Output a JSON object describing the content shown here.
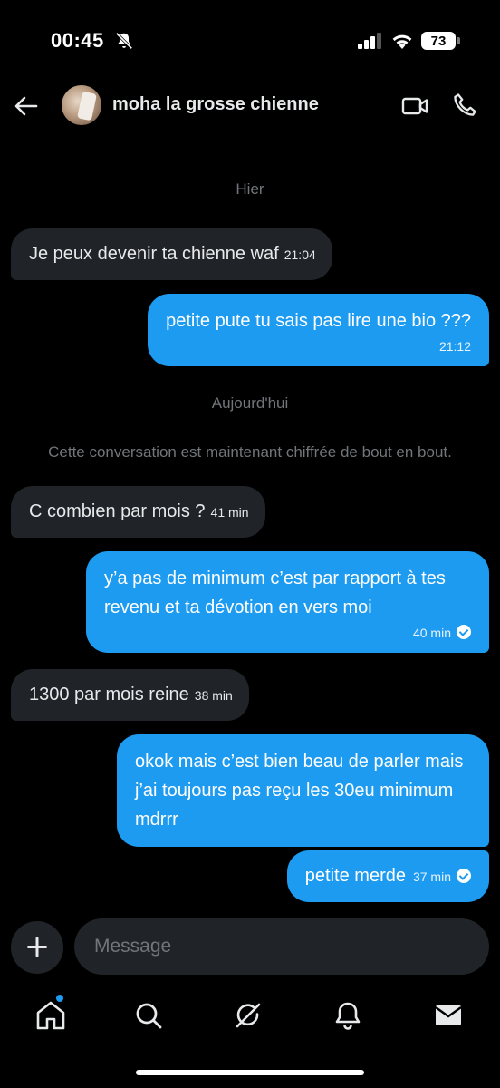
{
  "status_bar": {
    "time": "00:45",
    "battery": "73"
  },
  "header": {
    "contact_name": "moha la grosse chienne"
  },
  "chat": {
    "day_yesterday": "Hier",
    "day_today": "Aujourd'hui",
    "encryption_notice": "Cette conversation est maintenant chiffrée de bout en bout.",
    "messages": [
      {
        "direction": "in",
        "text": "Je peux devenir ta chienne waf",
        "time": "21:04"
      },
      {
        "direction": "out",
        "text": "petite pute tu sais pas lire une bio ???",
        "time": "21:12"
      },
      {
        "direction": "in",
        "text": "C combien par mois ?",
        "time": "41 min"
      },
      {
        "direction": "out",
        "text": "y’a pas de minimum c’est par rapport à tes revenu et ta dévotion en vers moi",
        "time": "40 min",
        "read": true
      },
      {
        "direction": "in",
        "text": "1300 par mois reine",
        "time": "38 min"
      },
      {
        "direction": "out",
        "text": "okok mais c’est bien beau de parler mais j’ai toujours pas reçu les 30eu minimum mdrrr",
        "time": ""
      },
      {
        "direction": "out",
        "text": "petite merde",
        "time": "37 min",
        "read": true
      }
    ]
  },
  "composer": {
    "placeholder": "Message"
  },
  "colors": {
    "accent": "#1d9bf0",
    "incoming_bubble": "#202327",
    "muted_text": "#71767b",
    "background": "#000000"
  },
  "nav": {
    "items": [
      "home-icon",
      "search-icon",
      "grok-icon",
      "notifications-icon",
      "messages-icon"
    ]
  }
}
